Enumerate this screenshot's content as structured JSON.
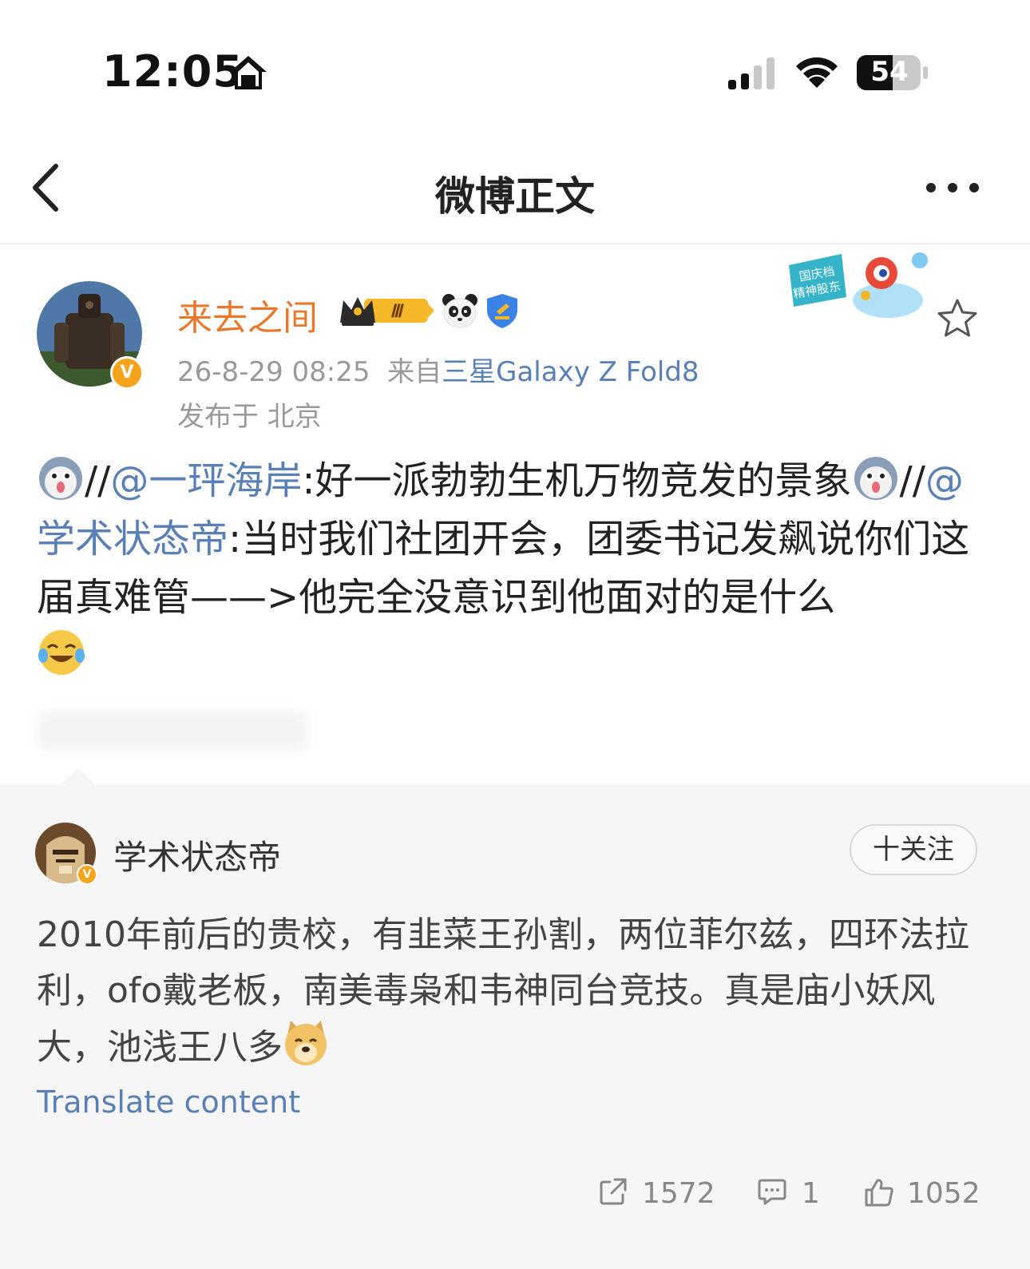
{
  "status_bar": {
    "time": "12:05",
    "battery": "54",
    "icons": [
      "home-icon",
      "signal-icon",
      "wifi-icon",
      "battery-icon"
    ]
  },
  "nav": {
    "title": "微博正文",
    "back_icon": "chevron-left-icon",
    "more_icon": "more-icon"
  },
  "post": {
    "author": {
      "name": "来去之间",
      "verified": "V",
      "badges": [
        "crown-badge",
        "panda-icon",
        "shield-icon"
      ],
      "crown_level": "Ⅲ"
    },
    "time": "26-8-29 08:25",
    "source_prefix": "来自",
    "source": "三星Galaxy Z Fold8",
    "location": "发布于 北京",
    "promo_sticker": {
      "line1": "国庆档",
      "line2": "精神股东"
    },
    "body": {
      "seg1": "//",
      "mention1": "@一玶海岸",
      "seg2": ":好一派勃勃生机万物竞发的景象",
      "seg3": "//",
      "mention2": "@学术状态帝",
      "seg4": ":当时我们社团开会，团委书记发飙说你们这届真难管——>他完全没意识到他面对的是什么"
    }
  },
  "retweet": {
    "author": "学术状态帝",
    "verified": "V",
    "follow_label": "十关注",
    "body": "2010年前后的贵校，有韭菜王孙割，两位菲尔兹，四环法拉利，ofo戴老板，南美毒枭和韦神同台竞技。真是庙小妖风大，池浅王八多",
    "translate": "Translate content",
    "actions": {
      "share_count": "1572",
      "comment_count": "1",
      "like_count": "1052"
    }
  },
  "colors": {
    "author_name": "#e8782b",
    "link": "#5a7fb4",
    "meta": "#999999",
    "retweet_bg": "#f6f6f6"
  }
}
